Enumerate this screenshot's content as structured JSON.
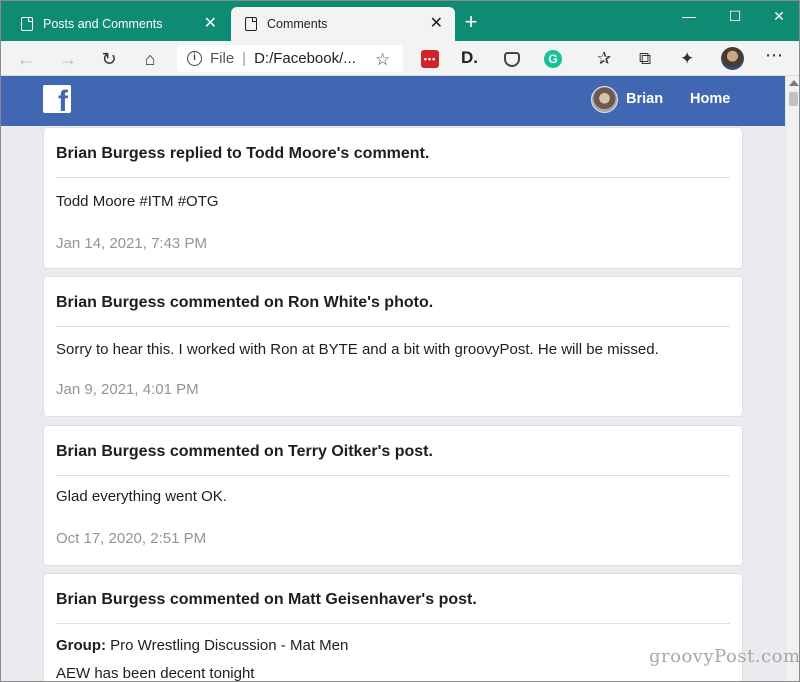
{
  "browser": {
    "tabs": [
      {
        "label": "Posts and Comments",
        "active": false
      },
      {
        "label": "Comments",
        "active": true
      }
    ],
    "address": {
      "scheme_label": "File",
      "url": "D:/Facebook/..."
    },
    "window_controls": {
      "minimize": "—",
      "maximize": "☐",
      "close": "✕"
    },
    "colors": {
      "titlebar": "#0f8a73",
      "toolbar": "#f3f3f3"
    }
  },
  "facebook": {
    "logo_text": "f",
    "user_name": "Brian",
    "home_label": "Home",
    "colors": {
      "bar": "#4267b2",
      "background": "#e9ebee",
      "date_text": "#90949c"
    }
  },
  "cards": [
    {
      "title": "Brian Burgess replied to Todd Moore's comment.",
      "body": "Todd Moore #ITM #OTG",
      "date": "Jan 14, 2021, 7:43 PM"
    },
    {
      "title": "Brian Burgess commented on Ron White's photo.",
      "body": "Sorry to hear this. I worked with Ron at BYTE and a bit with groovyPost. He will be missed.",
      "date": "Jan 9, 2021, 4:01 PM"
    },
    {
      "title": "Brian Burgess commented on Terry Oitker's post.",
      "body": "Glad everything went OK.",
      "date": "Oct 17, 2020, 2:51 PM"
    },
    {
      "title": "Brian Burgess commented on Matt Geisenhaver's post.",
      "group_label": "Group:",
      "group_name": "Pro Wrestling Discussion - Mat Men",
      "body": "AEW has been decent tonight"
    }
  ],
  "watermark": "groovyPost.com"
}
